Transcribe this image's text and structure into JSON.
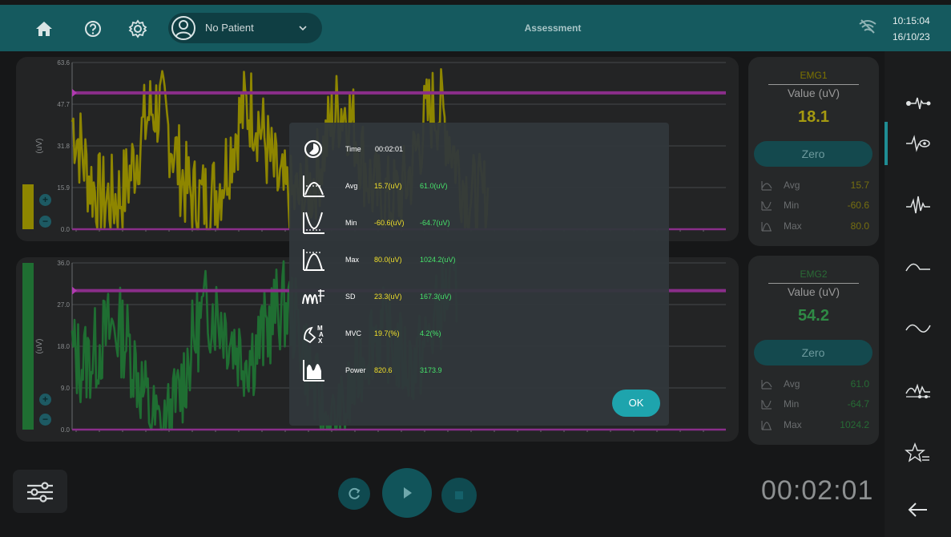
{
  "topbar": {
    "patient_name": "No Patient",
    "mode_title": "Assessment",
    "time": "10:15:04",
    "date": "16/10/23",
    "icons": [
      "home-icon",
      "help-icon",
      "settings-icon",
      "user-icon",
      "chevron-down-icon",
      "wifi-off-icon"
    ]
  },
  "charts": [
    {
      "id": "emg1",
      "color": "#8e8600",
      "threshold_color": "#8a2e8a",
      "ylabel": "(uV)",
      "yticks": [
        "63.6",
        "47.7",
        "31.8",
        "15.9",
        "0.0"
      ],
      "ymax": 63.6,
      "threshold": 52,
      "level_fill": 0.27
    },
    {
      "id": "emg2",
      "color": "#1f6e32",
      "threshold_color": "#8a2e8a",
      "ylabel": "(uV)",
      "yticks": [
        "36.0",
        "27.0",
        "18.0",
        "9.0",
        "0.0"
      ],
      "ymax": 36.0,
      "threshold": 30,
      "level_fill": 1.0
    }
  ],
  "cards": [
    {
      "channel": "EMG1",
      "channel_color": "#7c7300",
      "unit": "Value (uV)",
      "value": "18.1",
      "value_color": "#a59a10",
      "zero_label": "Zero",
      "stats": [
        {
          "label": "Avg",
          "value": "15.7"
        },
        {
          "label": "Min",
          "value": "-60.6"
        },
        {
          "label": "Max",
          "value": "80.0"
        }
      ],
      "stat_color": "#756e10"
    },
    {
      "channel": "EMG2",
      "channel_color": "#2a6b36",
      "unit": "Value (uV)",
      "value": "54.2",
      "value_color": "#2f8a45",
      "zero_label": "Zero",
      "stats": [
        {
          "label": "Avg",
          "value": "61.0"
        },
        {
          "label": "Min",
          "value": "-64.7"
        },
        {
          "label": "Max",
          "value": "1024.2"
        }
      ],
      "stat_color": "#266b35"
    }
  ],
  "dialog": {
    "rows": [
      {
        "label": "Time",
        "icon": "clock-icon",
        "v1": "00:02:01",
        "v2": ""
      },
      {
        "label": "Avg",
        "icon": "avg-icon",
        "v1": "15.7(uV)",
        "v2": "61.0(uV)"
      },
      {
        "label": "Min",
        "icon": "min-icon",
        "v1": "-60.6(uV)",
        "v2": "-64.7(uV)"
      },
      {
        "label": "Max",
        "icon": "max-icon",
        "v1": "80.0(uV)",
        "v2": "1024.2(uV)"
      },
      {
        "label": "SD",
        "icon": "sd-icon",
        "v1": "23.3(uV)",
        "v2": "167.3(uV)"
      },
      {
        "label": "MVC",
        "icon": "mvc-icon",
        "v1": "19.7(%)",
        "v2": "4.2(%)"
      },
      {
        "label": "Power",
        "icon": "power-icon",
        "v1": "820.6",
        "v2": "3173.9"
      }
    ],
    "ok_label": "OK"
  },
  "bottom": {
    "timer": "00:02:01",
    "controls": [
      "refresh-icon",
      "play-icon",
      "stop-icon"
    ]
  },
  "sidebar": {
    "items": [
      "signal-input-icon",
      "signal-view-icon",
      "raw-signal-icon",
      "envelope-icon",
      "smooth-icon",
      "mvc-icon",
      "favorites-icon",
      "back-arrow-icon"
    ],
    "active_index": 1
  },
  "colors": {
    "accent": "#1ea4ad",
    "emg1": "#f1e02a",
    "emg2": "#46e36b"
  }
}
